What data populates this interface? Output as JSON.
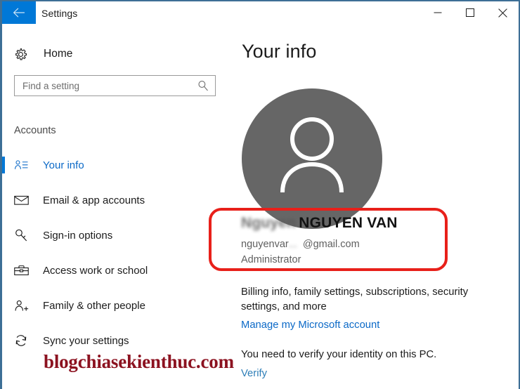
{
  "window": {
    "title": "Settings",
    "back_icon": "back-arrow-icon",
    "controls": {
      "minimize": "minimize-icon",
      "maximize": "maximize-icon",
      "close": "close-icon"
    },
    "accent_color": "#0078d7",
    "border_color": "#3d6f96"
  },
  "sidebar": {
    "home": {
      "label": "Home",
      "icon": "gear-icon"
    },
    "search": {
      "placeholder": "Find a setting",
      "value": "",
      "icon": "search-icon"
    },
    "section_title": "Accounts",
    "items": [
      {
        "label": "Your info",
        "icon": "user-info-icon",
        "selected": true
      },
      {
        "label": "Email & app accounts",
        "icon": "envelope-icon",
        "selected": false
      },
      {
        "label": "Sign-in options",
        "icon": "key-icon",
        "selected": false
      },
      {
        "label": "Access work or school",
        "icon": "briefcase-icon",
        "selected": false
      },
      {
        "label": "Family & other people",
        "icon": "user-plus-icon",
        "selected": false
      },
      {
        "label": "Sync your settings",
        "icon": "sync-icon",
        "selected": false
      }
    ]
  },
  "main": {
    "page_title": "Your info",
    "avatar": {
      "icon": "person-avatar-icon",
      "background_color": "#666666"
    },
    "account": {
      "name_redacted": "Nguyen",
      "name": "NGUYEN VAN",
      "email_prefix": "nguyenvar",
      "email_redacted": "...",
      "email_domain": "@gmail.com",
      "role": "Administrator"
    },
    "billing_text": "Billing info, family settings, subscriptions, security settings, and more",
    "manage_link": "Manage my Microsoft account",
    "verify_text": "You need to verify your identity on this PC.",
    "verify_link": "Verify"
  },
  "highlight": {
    "color": "#e8201a"
  },
  "watermark": {
    "text": "blogchiasekienthuc.com",
    "color": "#8c1220"
  }
}
